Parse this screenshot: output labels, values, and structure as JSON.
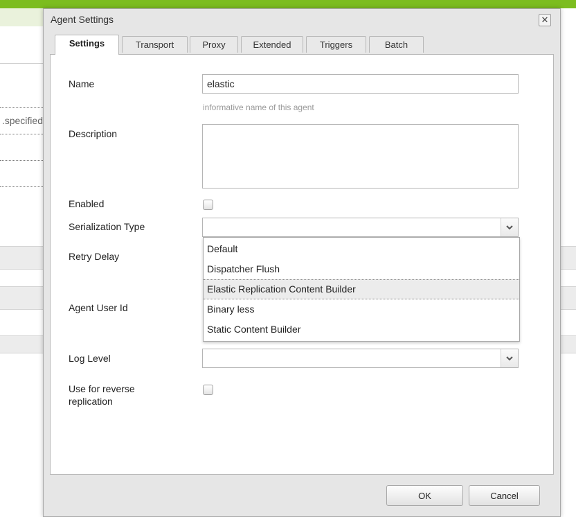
{
  "background": {
    "partial_text": "specified."
  },
  "dialog": {
    "title": "Agent Settings",
    "close_glyph": "✕",
    "tabs": [
      {
        "label": "Settings",
        "active": true
      },
      {
        "label": "Transport",
        "active": false
      },
      {
        "label": "Proxy",
        "active": false
      },
      {
        "label": "Extended",
        "active": false
      },
      {
        "label": "Triggers",
        "active": false
      },
      {
        "label": "Batch",
        "active": false
      }
    ],
    "fields": {
      "name": {
        "label": "Name",
        "value": "elastic",
        "hint": "informative name of this agent"
      },
      "description": {
        "label": "Description",
        "value": ""
      },
      "enabled": {
        "label": "Enabled",
        "checked": false
      },
      "serialization_type": {
        "label": "Serialization Type",
        "value": "",
        "options": [
          "Default",
          "Dispatcher Flush",
          "Elastic Replication Content Builder",
          "Binary less",
          "Static Content Builder"
        ],
        "highlighted_option": "Elastic Replication Content Builder"
      },
      "retry_delay": {
        "label": "Retry Delay"
      },
      "agent_user_id": {
        "label": "Agent User Id"
      },
      "log_level": {
        "label": "Log Level",
        "value": ""
      },
      "reverse_replication": {
        "label_line1": "Use for reverse",
        "label_line2": "replication",
        "checked": false
      }
    },
    "buttons": {
      "ok": "OK",
      "cancel": "Cancel"
    }
  }
}
